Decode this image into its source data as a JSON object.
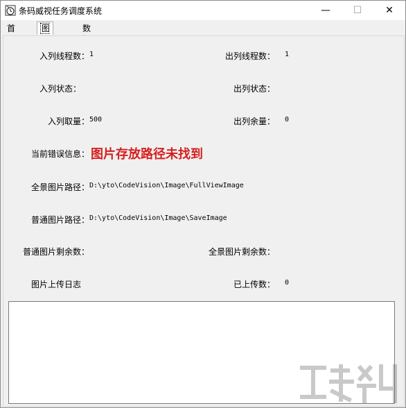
{
  "window": {
    "title": "条码威视任务调度系统",
    "controls": {
      "minimize": "—",
      "maximize": "☐",
      "close": "✕"
    }
  },
  "tabs": [
    {
      "label": "首页",
      "selected": false
    },
    {
      "label": "图片上传",
      "selected": true
    },
    {
      "label": "数据上传",
      "selected": false
    }
  ],
  "queue": {
    "in_threads_label": "入列线程数：",
    "in_threads_value": "1",
    "out_threads_label": "出列线程数：",
    "out_threads_value": "1",
    "in_status_label": "入列状态：",
    "out_status_label": "出列状态：",
    "in_take_label": "入列取量：",
    "in_take_value": "500",
    "out_remain_label": "出列余量：",
    "out_remain_value": "0"
  },
  "error": {
    "label": "当前错误信息：",
    "message": "图片存放路径未找到",
    "color": "#d81e1e"
  },
  "paths": {
    "full_label": "全景图片路径：",
    "full_value": "D:\\yto\\CodeVision\\Image\\FullViewImage",
    "normal_label": "普通图片路径：",
    "normal_value": "D:\\yto\\CodeVision\\Image\\SaveImage"
  },
  "remaining": {
    "normal_label": "普通图片剩余数：",
    "full_label": "全景图片剩余数："
  },
  "upload": {
    "log_label": "图片上传日志",
    "uploaded_label": "已上传数：",
    "uploaded_value": "0"
  },
  "log": {
    "content": ""
  }
}
